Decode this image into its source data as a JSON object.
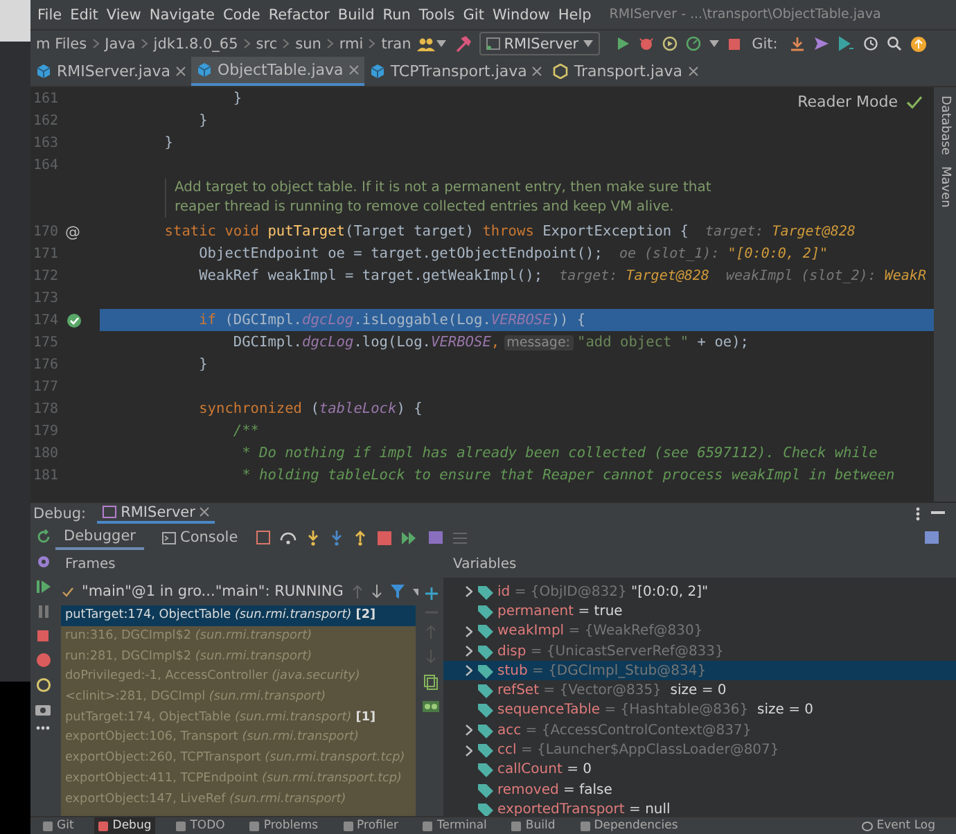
{
  "window": {
    "title": "RMIServer - ...\\transport\\ObjectTable.java"
  },
  "menu": [
    "File",
    "Edit",
    "View",
    "Navigate",
    "Code",
    "Refactor",
    "Build",
    "Run",
    "Tools",
    "Git",
    "Window",
    "Help"
  ],
  "breadcrumb": [
    "m Files",
    "Java",
    "jdk1.8.0_65",
    "src",
    "sun",
    "rmi",
    "tran"
  ],
  "run_config": "RMIServer",
  "git_label": "Git:",
  "tabs": [
    {
      "label": "RMIServer.java",
      "kind": "class",
      "selected": false
    },
    {
      "label": "ObjectTable.java",
      "kind": "class",
      "selected": true
    },
    {
      "label": "TCPTransport.java",
      "kind": "class",
      "selected": false
    },
    {
      "label": "Transport.java",
      "kind": "abstract",
      "selected": false
    }
  ],
  "reader_mode": "Reader Mode",
  "side_tools": [
    "Database",
    "Maven"
  ],
  "editor": {
    "lines_top": [
      {
        "number": "161",
        "breakpoint": false,
        "selected": false,
        "segments": [
          {
            "kind": "code",
            "tokens": [
              {
                "t": "            }",
                "kind": "plain"
              }
            ]
          }
        ]
      },
      {
        "number": "162",
        "breakpoint": false,
        "selected": false,
        "segments": [
          {
            "kind": "code",
            "tokens": [
              {
                "t": "        }",
                "kind": "plain"
              }
            ]
          }
        ]
      },
      {
        "number": "163",
        "breakpoint": false,
        "selected": false,
        "segments": [
          {
            "kind": "code",
            "tokens": [
              {
                "t": "    }",
                "kind": "plain"
              }
            ]
          }
        ]
      },
      {
        "number": "164",
        "breakpoint": false,
        "selected": false
      }
    ],
    "doc": [
      "Add target to object table. If it is not a permanent entry, then make sure that",
      "reaper thread is running to remove collected entries and keep VM alive."
    ],
    "lines": [
      {
        "number": "170",
        "gutter_mark": "@",
        "breakpoint": false,
        "selected": false,
        "segments": [
          {
            "kind": "code",
            "tokens": [
              {
                "t": "    static void ",
                "kind": "kw"
              },
              {
                "t": "putTarget",
                "kind": "fn"
              },
              {
                "t": "(Target target) ",
                "kind": "plain"
              },
              {
                "t": "throws ",
                "kind": "kw"
              },
              {
                "t": "ExportException {",
                "kind": "plain"
              }
            ]
          },
          {
            "kind": "hint",
            "label": "target: ",
            "value": "Target@828"
          }
        ]
      },
      {
        "number": "171",
        "breakpoint": false,
        "selected": false,
        "segments": [
          {
            "kind": "code",
            "tokens": [
              {
                "t": "        ObjectEndpoint oe = target.getObjectEndpoint();",
                "kind": "plain"
              }
            ]
          },
          {
            "kind": "hint",
            "label": "oe (slot_1): ",
            "value": "\"[0:0:0, 2]\""
          }
        ]
      },
      {
        "number": "172",
        "breakpoint": false,
        "selected": false,
        "segments": [
          {
            "kind": "code",
            "tokens": [
              {
                "t": "        WeakRef weakImpl = target.getWeakImpl();",
                "kind": "plain"
              }
            ]
          },
          {
            "kind": "hint",
            "label": "target: ",
            "value": "Target@828"
          },
          {
            "kind": "hint",
            "label": "weakImpl (slot_2): ",
            "value": "WeakR"
          }
        ]
      },
      {
        "number": "173",
        "breakpoint": false,
        "selected": false
      },
      {
        "number": "174",
        "breakpoint": true,
        "selected": true,
        "segments": [
          {
            "kind": "code",
            "tokens": [
              {
                "t": "        if ",
                "kind": "kw"
              },
              {
                "t": "(DGCImpl.",
                "kind": "plain"
              },
              {
                "t": "dgcLog",
                "kind": "field"
              },
              {
                "t": ".isLoggable(Log.",
                "kind": "plain"
              },
              {
                "t": "VERBOSE",
                "kind": "field"
              },
              {
                "t": ")) {",
                "kind": "plain"
              }
            ]
          }
        ]
      },
      {
        "number": "175",
        "breakpoint": false,
        "selected": false,
        "segments": [
          {
            "kind": "code",
            "tokens": [
              {
                "t": "            DGCImpl.",
                "kind": "plain"
              },
              {
                "t": "dgcLog",
                "kind": "field"
              },
              {
                "t": ".log(Log.",
                "kind": "plain"
              },
              {
                "t": "VERBOSE",
                "kind": "field"
              },
              {
                "t": ",",
                "kind": "kw"
              }
            ]
          },
          {
            "kind": "param",
            "text": "message:"
          },
          {
            "kind": "code",
            "tokens": [
              {
                "t": "\"add object \"",
                "kind": "str"
              },
              {
                "t": " + oe);",
                "kind": "plain"
              }
            ]
          }
        ]
      },
      {
        "number": "176",
        "breakpoint": false,
        "selected": false,
        "segments": [
          {
            "kind": "code",
            "tokens": [
              {
                "t": "        }",
                "kind": "plain"
              }
            ]
          }
        ]
      },
      {
        "number": "177",
        "breakpoint": false,
        "selected": false
      },
      {
        "number": "178",
        "breakpoint": false,
        "selected": false,
        "segments": [
          {
            "kind": "code",
            "tokens": [
              {
                "t": "        synchronized ",
                "kind": "kw"
              },
              {
                "t": "(",
                "kind": "plain"
              },
              {
                "t": "tableLock",
                "kind": "field"
              },
              {
                "t": ") {",
                "kind": "plain"
              }
            ]
          }
        ]
      },
      {
        "number": "179",
        "breakpoint": false,
        "selected": false,
        "segments": [
          {
            "kind": "code",
            "tokens": [
              {
                "t": "            /**",
                "kind": "comment"
              }
            ]
          }
        ]
      },
      {
        "number": "180",
        "breakpoint": false,
        "selected": false,
        "segments": [
          {
            "kind": "code",
            "tokens": [
              {
                "t": "             * Do nothing if impl has already been collected (see 6597112). Check while",
                "kind": "comment"
              }
            ]
          }
        ]
      },
      {
        "number": "181",
        "breakpoint": false,
        "selected": false,
        "segments": [
          {
            "kind": "code",
            "tokens": [
              {
                "t": "             * holding tableLock to ensure that Reaper cannot process weakImpl in between",
                "kind": "comment"
              }
            ]
          }
        ]
      }
    ]
  },
  "debug": {
    "label": "Debug:",
    "session": "RMIServer",
    "tabs": [
      {
        "label": "Debugger",
        "selected": true
      },
      {
        "label": "Console",
        "selected": false
      }
    ],
    "frames_title": "Frames",
    "variables_title": "Variables",
    "thread": "\"main\"@1 in gro...\"main\": RUNNING",
    "frames": [
      {
        "method": "putTarget:174, ObjectTable ",
        "package": "(sun.rmi.transport)",
        "badge": " [2]",
        "selected": true
      },
      {
        "method": "run:316, DGCImpl$2 ",
        "package": "(sun.rmi.transport)",
        "selected": false
      },
      {
        "method": "run:281, DGCImpl$2 ",
        "package": "(sun.rmi.transport)",
        "selected": false
      },
      {
        "method": "doPrivileged:-1, AccessController ",
        "package": "(java.security)",
        "selected": false
      },
      {
        "method": "<clinit>:281, DGCImpl ",
        "package": "(sun.rmi.transport)",
        "selected": false
      },
      {
        "method": "putTarget:174, ObjectTable ",
        "package": "(sun.rmi.transport)",
        "badge": " [1]",
        "selected": false
      },
      {
        "method": "exportObject:106, Transport ",
        "package": "(sun.rmi.transport)",
        "selected": false
      },
      {
        "method": "exportObject:260, TCPTransport ",
        "package": "(sun.rmi.transport.tcp)",
        "selected": false
      },
      {
        "method": "exportObject:411, TCPEndpoint ",
        "package": "(sun.rmi.transport.tcp)",
        "selected": false
      },
      {
        "method": "exportObject:147, LiveRef ",
        "package": "(sun.rmi.transport)",
        "selected": false
      }
    ],
    "variables": [
      {
        "name": "id",
        "value": " = {ObjID@832}",
        "kind": "object",
        "extra": " \"[0:0:0, 2]\"",
        "expandable": true,
        "selected": false
      },
      {
        "name": "permanent",
        "value": " = true",
        "kind": "primitive",
        "expandable": false,
        "selected": false
      },
      {
        "name": "weakImpl",
        "value": " = {WeakRef@830}",
        "kind": "object",
        "expandable": true,
        "selected": false
      },
      {
        "name": "disp",
        "value": " = {UnicastServerRef@833}",
        "kind": "object",
        "expandable": true,
        "selected": false
      },
      {
        "name": "stub",
        "value": " = {DGCImpl_Stub@834}",
        "kind": "object",
        "expandable": true,
        "selected": true
      },
      {
        "name": "refSet",
        "value": " = {Vector@835}",
        "kind": "object",
        "extra": "  size = 0",
        "expandable": false,
        "selected": false
      },
      {
        "name": "sequenceTable",
        "value": " = {Hashtable@836}",
        "kind": "object",
        "extra": "  size = 0",
        "expandable": false,
        "selected": false
      },
      {
        "name": "acc",
        "value": " = {AccessControlContext@837}",
        "kind": "object",
        "expandable": true,
        "selected": false
      },
      {
        "name": "ccl",
        "value": " = {Launcher$AppClassLoader@807}",
        "kind": "object",
        "expandable": true,
        "selected": false
      },
      {
        "name": "callCount",
        "value": " = 0",
        "kind": "primitive",
        "expandable": false,
        "selected": false
      },
      {
        "name": "removed",
        "value": " = false",
        "kind": "primitive",
        "expandable": false,
        "selected": false
      },
      {
        "name": "exportedTransport",
        "value": " = null",
        "kind": "primitive",
        "expandable": false,
        "selected": false
      }
    ]
  },
  "bottom_tools": [
    {
      "label": "Git",
      "selected": false
    },
    {
      "label": "Debug",
      "selected": true
    },
    {
      "label": "TODO",
      "selected": false
    },
    {
      "label": "Problems",
      "selected": false
    },
    {
      "label": "Profiler",
      "selected": false
    },
    {
      "label": "Terminal",
      "selected": false
    },
    {
      "label": "Build",
      "selected": false
    },
    {
      "label": "Dependencies",
      "selected": false
    }
  ],
  "event_log": "Event Log"
}
